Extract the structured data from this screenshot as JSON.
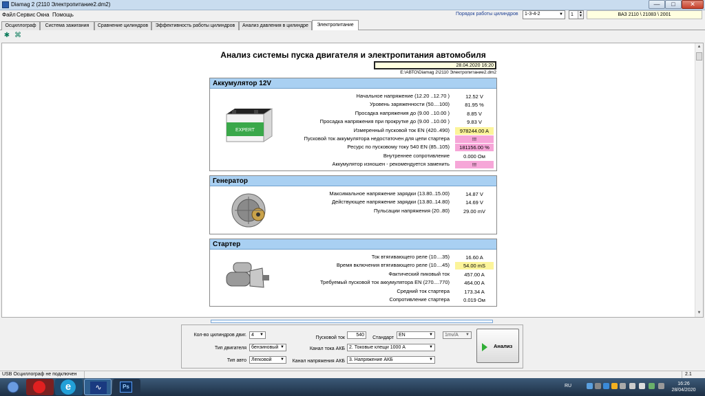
{
  "window": {
    "title": "Diamag 2 (2110 Электропитание2.dm2)",
    "min_glyph": "—",
    "max_glyph": "□",
    "close_glyph": "✕"
  },
  "menu": [
    "Файл",
    "Сервис",
    "Окна",
    "Помощь"
  ],
  "header_controls": {
    "cyl_order_label": "Порядок работы цилиндров",
    "cyl_order_value": "1-3-4-2",
    "cyl_number_value": "1",
    "vehicle": "ВАЗ 2110 \\ 21083 \\ 2001"
  },
  "tabs": [
    "Осциллограф",
    "Система зажигания",
    "Сравнение цилиндров",
    "Эффективность работы цилиндров",
    "Анализ давления в цилиндре",
    "Электропитание"
  ],
  "report": {
    "title": "Анализ системы пуска двигателя и электропитания автомобиля",
    "date": "28.04.2020 16:20",
    "file": "E:\\АВТО\\Diamag 2\\2110 Электропитание2.dm2",
    "battery": {
      "header": "Аккумулятор 12V",
      "image_label": "EXPERT",
      "rows": [
        {
          "label": "Начальное напряжение (12.20 ..12.70 )",
          "value": "12.52 V",
          "hl": ""
        },
        {
          "label": "Уровень заряженности (50....100)",
          "value": "81.95 %",
          "hl": ""
        },
        {
          "label": "Просадка напряжения до (9.00 ..10.00 )",
          "value": "8.85 V",
          "hl": ""
        },
        {
          "label": "Просадка напряжения при прокрутке до (9.00 ..10.00 )",
          "value": "9.83 V",
          "hl": ""
        },
        {
          "label": "Измеренный пусковой ток  EN (420..490)",
          "value": "978244.00 A",
          "hl": "yellow"
        },
        {
          "label": "Пусковой ток аккумулятора недостаточен для цепи стартера",
          "value": "!!!",
          "hl": "pink"
        },
        {
          "label": "Ресурс по пусковому току  540 EN (85..105)",
          "value": "181156.00 %",
          "hl": "pink"
        },
        {
          "label": "Внутреннее сопротивление",
          "value": "0.000 Ом",
          "hl": ""
        },
        {
          "label": "Аккумулятор изношен - рекомендуется заменить",
          "value": "!!!",
          "hl": "pink"
        }
      ]
    },
    "generator": {
      "header": "Генератор",
      "rows": [
        {
          "label": "Максимальное напряжение зарядки  (13.80..15.00)",
          "value": "14.87 V",
          "hl": ""
        },
        {
          "label": "Действующее напряжение зарядки  (13.80..14.80)",
          "value": "14.69 V",
          "hl": ""
        },
        {
          "label": "Пульсации напряжения (20..80)",
          "value": "29.00 mV",
          "hl": ""
        }
      ]
    },
    "starter": {
      "header": "Стартер",
      "rows": [
        {
          "label": "Ток втягивающего реле (10....35)",
          "value": "16.60 A",
          "hl": ""
        },
        {
          "label": "Время включения втягивающего реле (10....45)",
          "value": "54.00 mS",
          "hl": "yellow"
        },
        {
          "label": "Фактический пиковый ток",
          "value": "457.00 A",
          "hl": ""
        },
        {
          "label": "Требуемый пусковой ток аккумулятора  EN (270....770)",
          "value": "464.00 A",
          "hl": ""
        },
        {
          "label": "Средний ток стартера",
          "value": "173.34 A",
          "hl": ""
        },
        {
          "label": "Сопротивление стартера",
          "value": "0.019 Ом",
          "hl": ""
        }
      ]
    }
  },
  "controls": {
    "cylinders_label": "Кол-во цилиндров двиг.",
    "cylinders_value": "4",
    "engine_type_label": "Тип двигателя",
    "engine_type_value": "бензиновый",
    "vehicle_type_label": "Тип авто",
    "vehicle_type_value": "Легковой",
    "start_current_label": "Пусковой ток",
    "start_current_value": "540",
    "standard_label": "Стандарт",
    "standard_value": "EN",
    "akb_current_channel_label": "Канал тока АКБ",
    "akb_current_channel_value": "2. Токовые клещи 1000 А",
    "akb_voltage_channel_label": "Канал напряжения АКБ",
    "akb_voltage_channel_value": "3. Напряжение АКБ",
    "scale_value": "1mv/A",
    "analyze_label": "Анализ"
  },
  "status": {
    "left": "USB Осциллограф не подключен",
    "right": "2.1"
  },
  "taskbar": {
    "lang": "RU",
    "time": "16:26",
    "date": "28/04/2020",
    "ie_glyph": "e",
    "diag_glyph": "∿",
    "ps_glyph": "Ps"
  },
  "colors": {
    "section_header": "#a9d0f2",
    "highlight_yellow": "#fcf49a",
    "highlight_pink": "#f6a6d8",
    "analyze_play": "#2fae36"
  }
}
